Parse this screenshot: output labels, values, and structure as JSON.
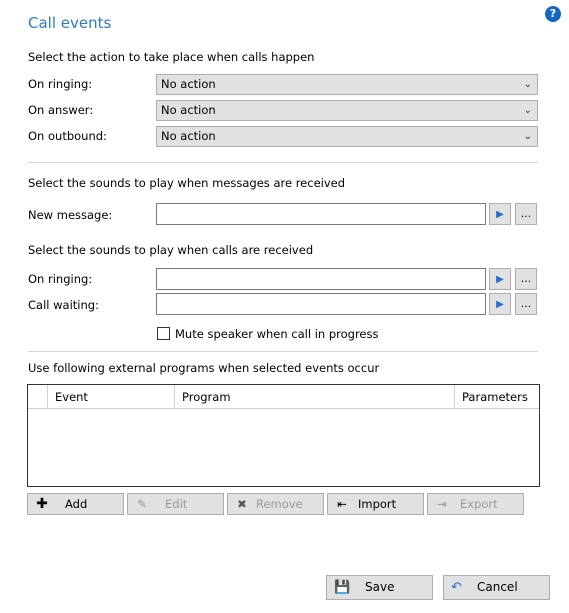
{
  "header": {
    "title": "Call events",
    "help_label": "?"
  },
  "actions": {
    "heading": "Select the action to take place when calls happen",
    "rows": [
      {
        "label": "On ringing:",
        "value": "No action"
      },
      {
        "label": "On answer:",
        "value": "No action"
      },
      {
        "label": "On outbound:",
        "value": "No action"
      }
    ]
  },
  "message_sounds": {
    "heading": "Select the sounds to play when messages are received",
    "rows": [
      {
        "label": "New message:",
        "value": ""
      }
    ]
  },
  "call_sounds": {
    "heading": "Select the sounds to play when calls are received",
    "rows": [
      {
        "label": "On ringing:",
        "value": ""
      },
      {
        "label": "Call waiting:",
        "value": ""
      }
    ],
    "mute_label": "Mute speaker when call in progress",
    "mute_checked": false
  },
  "programs": {
    "heading": "Use following external programs when selected events occur",
    "columns": [
      "Event",
      "Program",
      "Parameters"
    ]
  },
  "toolbar": {
    "add": "Add",
    "edit": "Edit",
    "remove": "Remove",
    "import": "Import",
    "export": "Export"
  },
  "footer": {
    "save": "Save",
    "cancel": "Cancel"
  },
  "icons": {
    "browse": "...",
    "play": "play-icon",
    "dropdown": "chevron-down-icon"
  },
  "colors": {
    "accent": "#2b7bd0",
    "help": "#1566c0",
    "play": "#1e6fd0"
  }
}
